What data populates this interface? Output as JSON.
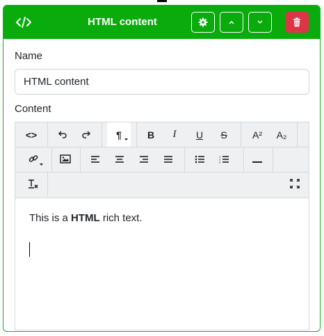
{
  "header": {
    "title": "HTML content",
    "icon": "code-icon",
    "accent_color": "#0aab0d",
    "buttons": [
      {
        "name": "settings-button",
        "icon": "gear-icon"
      },
      {
        "name": "move-up-button",
        "icon": "chevron-up-icon"
      },
      {
        "name": "move-down-button",
        "icon": "chevron-down-icon"
      },
      {
        "name": "delete-button",
        "icon": "trash-icon",
        "color": "#dc3545"
      }
    ]
  },
  "form": {
    "name_label": "Name",
    "name_value": "HTML content",
    "content_label": "Content"
  },
  "toolbar": {
    "row1": [
      "code-view",
      "undo",
      "redo",
      "paragraph",
      "bold",
      "italic",
      "underline",
      "strikethrough",
      "superscript",
      "subscript"
    ],
    "row2": [
      "link",
      "image",
      "align-left",
      "align-center",
      "align-right",
      "justify",
      "bullet-list",
      "numbered-list",
      "horizontal-rule"
    ],
    "row3": [
      "clear-format",
      "fullscreen"
    ],
    "labels": {
      "code": "<>",
      "paragraph": "¶",
      "bold": "B",
      "italic": "I",
      "underline": "U",
      "strike": "S",
      "superscript": "A²",
      "subscript": "A₂"
    }
  },
  "editor_content": {
    "text_before": "This is a ",
    "text_bold": "HTML",
    "text_after": " rich text."
  }
}
